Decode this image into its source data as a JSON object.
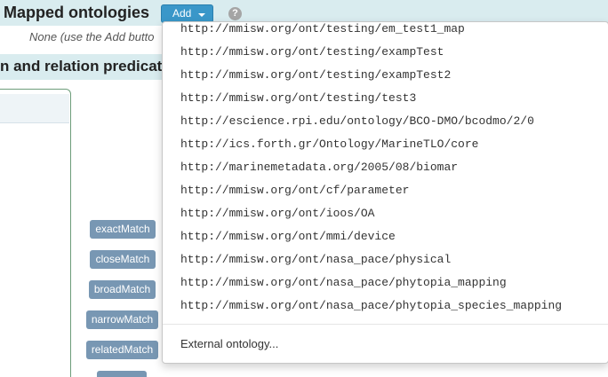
{
  "header": {
    "title": "Mapped ontologies",
    "add_label": "Add",
    "help_glyph": "?"
  },
  "note": "None (use the Add butto",
  "section": {
    "title": "n and relation predicat"
  },
  "predicates": [
    "exactMatch",
    "closeMatch",
    "broadMatch",
    "narrowMatch",
    "relatedMatch"
  ],
  "dropdown": {
    "items": [
      "http://mmisw.org/ont/testing/em_test1_map",
      "http://mmisw.org/ont/testing/exampTest",
      "http://mmisw.org/ont/testing/exampTest2",
      "http://mmisw.org/ont/testing/test3",
      "http://escience.rpi.edu/ontology/BCO-DMO/bcodmo/2/0",
      "http://ics.forth.gr/Ontology/MarineTLO/core",
      "http://marinemetadata.org/2005/08/biomar",
      "http://mmisw.org/ont/cf/parameter",
      "http://mmisw.org/ont/ioos/OA",
      "http://mmisw.org/ont/mmi/device",
      "http://mmisw.org/ont/nasa_pace/physical",
      "http://mmisw.org/ont/nasa_pace/phytopia_mapping",
      "http://mmisw.org/ont/nasa_pace/phytopia_species_mapping"
    ],
    "external_label": "External ontology..."
  },
  "colors": {
    "header_bg": "#d9ecef",
    "add_button": "#3a97c9",
    "predicate_button": "#7897b3",
    "panel_border": "#6d9d7a"
  }
}
